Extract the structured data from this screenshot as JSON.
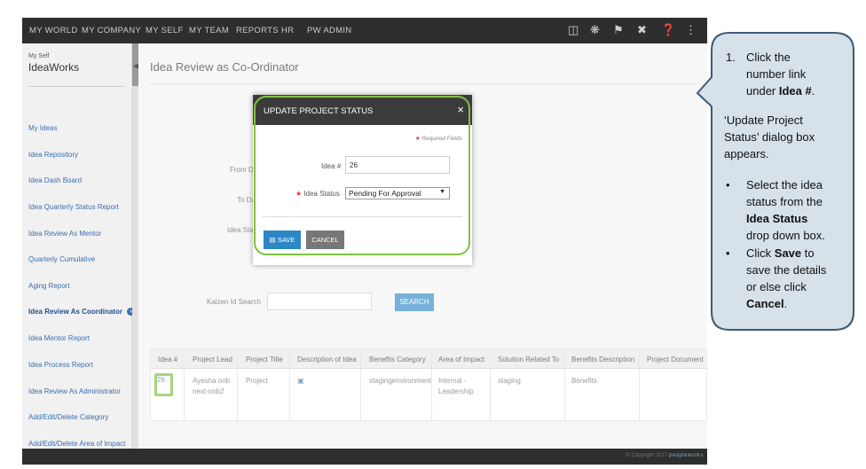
{
  "topnav": {
    "items": [
      "MY WORLD",
      "MY COMPANY",
      "MY SELF",
      "MY TEAM",
      "REPORTS",
      "HR",
      "PW ADMIN"
    ],
    "icons": [
      "book-icon",
      "lightbulb-icon",
      "flag-icon",
      "tools-icon",
      "help-icon",
      "share-icon"
    ]
  },
  "sidebar": {
    "section_small": "My Self",
    "section_big": "IdeaWorks",
    "items": [
      "My Ideas",
      "Idea Repository",
      "Idea Dash Board",
      "Idea Quarterly Status Report",
      "Idea Review As Mentor",
      "Quarterly Cumulative",
      "Aging Report",
      "Idea Review As Coordinator",
      "Idea Mentor Report",
      "Idea Process Report",
      "Idea Review As Administrator",
      "Add/Edit/Delete Category",
      "Add/Edit/Delete Area of Impact"
    ],
    "active_index": 7
  },
  "main": {
    "title": "Idea Review as Co-Ordinator",
    "labels": {
      "from": "From Da",
      "to": "To Da",
      "status": "Idea Sta",
      "kaizen": "Kaizen Id Search"
    },
    "search_label": "SEARCH"
  },
  "table": {
    "headers": [
      "Idea #",
      "Project Lead",
      "Project Title",
      "Description of Idea",
      "Benefits Category",
      "Area of Impact",
      "Solution Related To",
      "Benefits Description",
      "Project Document"
    ],
    "row": {
      "idea": "26",
      "lead": "Ayesha onb next-onb2",
      "title": "Project",
      "description_icon": "document-icon",
      "benefits_category": "stagingenvironment",
      "area_of_impact": "Internal - Leadership",
      "solution": "staging",
      "benefits_description": "Benefits",
      "document": ""
    }
  },
  "footer": {
    "copyright": "© Copyright 2017",
    "brand": "peopleworks"
  },
  "modal": {
    "title": "UPDATE PROJECT STATUS",
    "close": "×",
    "required_note": "Required Fields",
    "idea_label": "Idea #",
    "idea_value": "26",
    "status_label": "Idea Status",
    "status_value": "Pending For Approval",
    "save_label": "SAVE",
    "cancel_label": "CANCEL"
  },
  "callout": {
    "step1_num": "1.",
    "step1_a": "Click the",
    "step1_b": "number link",
    "step1_c_pre": "under ",
    "step1_c_bold": "Idea #",
    "step1_c_post": ".",
    "para_1": "‘Update Project",
    "para_2": "Status’ dialog box",
    "para_3": "appears.",
    "b1_1": "Select the idea",
    "b1_2": "status from the",
    "b1_3": "Idea Status",
    "b1_4": "drop down box.",
    "b2_1_pre": "Click ",
    "b2_1_bold": "Save",
    "b2_1_post": " to",
    "b2_2": "save the details",
    "b2_3": "or else click",
    "b2_4_bold": "Cancel",
    "b2_4_post": "."
  },
  "colors": {
    "accent": "#2d87c7",
    "highlight": "#7fc242",
    "callout_fill": "#d6e1ea",
    "callout_border": "#3d5a73"
  }
}
